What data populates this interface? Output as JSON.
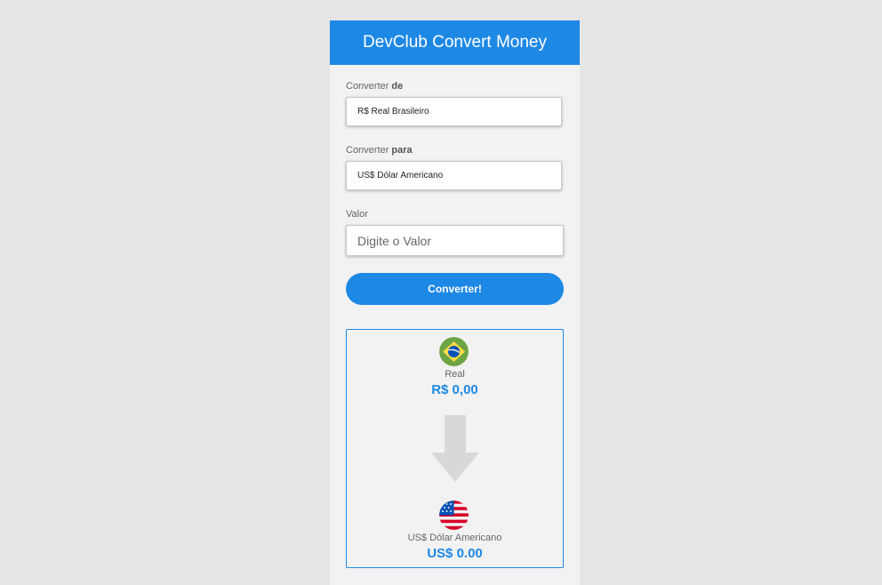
{
  "app": {
    "title": "DevClub Convert Money"
  },
  "form": {
    "from_label_prefix": "Converter ",
    "from_label_strong": "de",
    "from_value": "R$ Real Brasileiro",
    "to_label_prefix": "Converter ",
    "to_label_strong": "para",
    "to_value": "US$ Dólar Americano",
    "amount_label": "Valor",
    "amount_placeholder": "Digite o Valor",
    "convert_button": "Converter!"
  },
  "result": {
    "from_name": "Real",
    "from_value": "R$ 0,00",
    "from_icon": "brazil-flag-icon",
    "to_name": "US$ Dólar Americano",
    "to_value": "US$ 0.00",
    "to_icon": "usa-flag-icon",
    "arrow_icon": "arrow-down-icon"
  },
  "colors": {
    "accent": "#1e88e5",
    "background": "#e5e5e5",
    "card": "#f2f2f2"
  }
}
